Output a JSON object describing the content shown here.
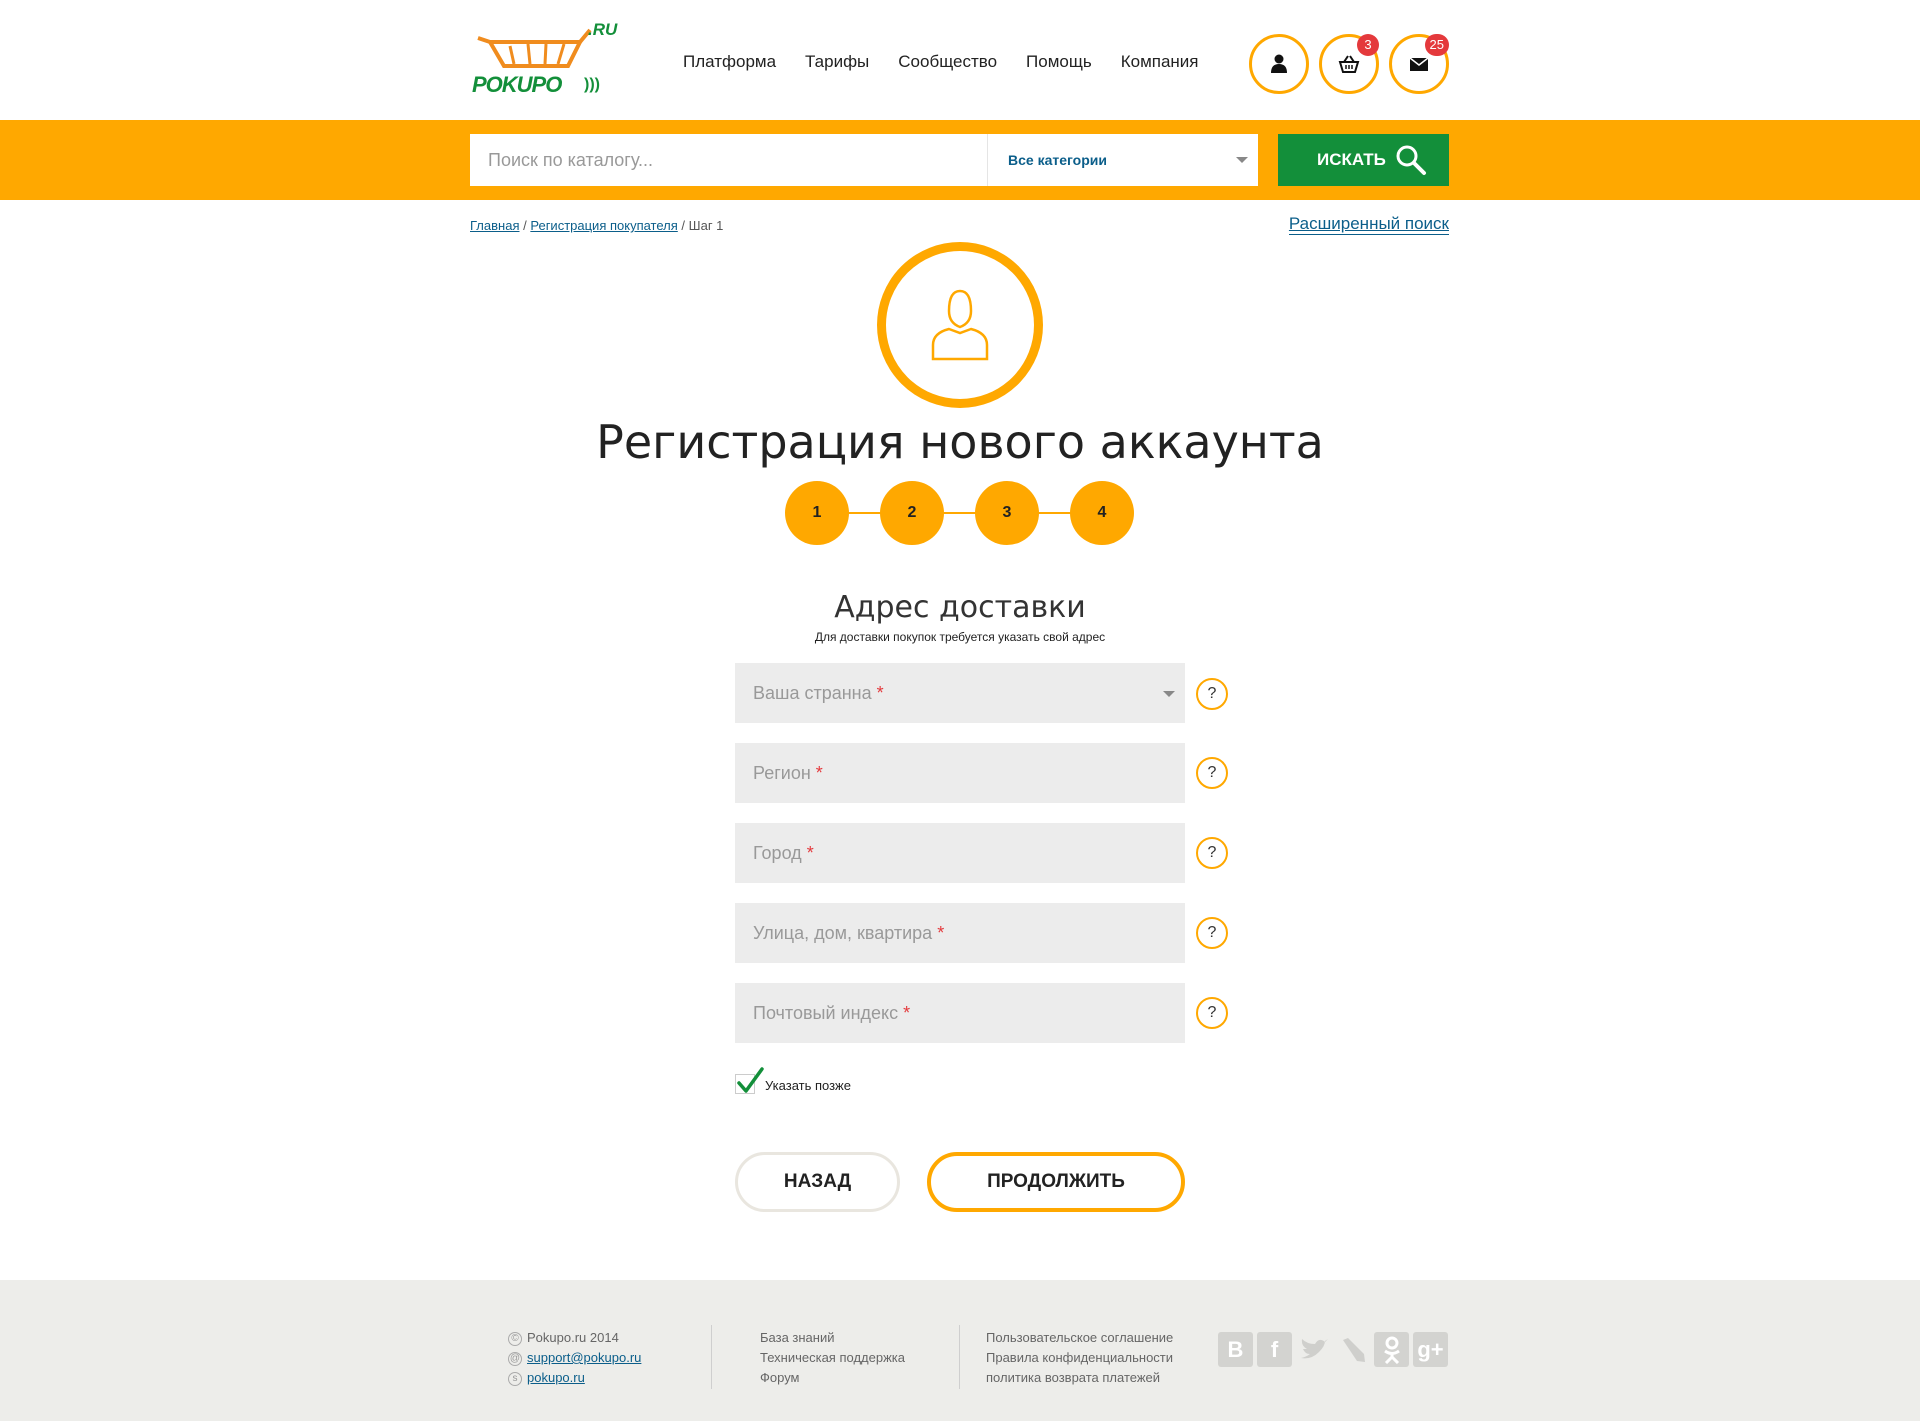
{
  "header": {
    "logo_text": "POKUPO",
    "logo_suffix": ".RU",
    "nav": [
      "Платформа",
      "Тарифы",
      "Сообщество",
      "Помощь",
      "Компания"
    ],
    "cart_count": "3",
    "messages_count": "25"
  },
  "search": {
    "placeholder": "Поиск по каталогу...",
    "category": "Все категории",
    "button": "ИСКАТЬ"
  },
  "breadcrumb": {
    "home": "Главная",
    "registration": "Регистрация покупателя",
    "current": "Шаг 1",
    "sep": "/"
  },
  "advanced_search": "Расширенный поиск",
  "page_title": "Регистрация нового аккаунта",
  "steps": [
    "1",
    "2",
    "3",
    "4"
  ],
  "section": {
    "title": "Адрес доставки",
    "subtitle": "Для доставки покупок требуется указать свой адрес"
  },
  "form": {
    "country": "Ваша странна",
    "region": "Регион",
    "city": "Город",
    "street": "Улица, дом, квартира",
    "zip": "Почтовый индекс",
    "required_mark": "*",
    "help": "?",
    "later_label": "Указать позже",
    "later_checked": true
  },
  "buttons": {
    "back": "НАЗАД",
    "next": "ПРОДОЛЖИТЬ"
  },
  "footer": {
    "copyright": "Pokupo.ru 2014",
    "email": "support@pokupo.ru",
    "skype": "pokupo.ru",
    "links1": [
      "База знаний",
      "Техническая поддержка",
      "Форум"
    ],
    "links2": [
      "Пользовательское соглашение",
      "Правила конфиденциальности",
      "политика возврата платежей"
    ],
    "socials": [
      "vk-icon",
      "facebook-icon",
      "twitter-icon",
      "livejournal-icon",
      "odnoklassniki-icon",
      "googleplus-icon"
    ]
  },
  "colors": {
    "accent": "#ffa800",
    "green": "#138f3a",
    "link": "#0b5e8a",
    "required": "#e4393c"
  }
}
